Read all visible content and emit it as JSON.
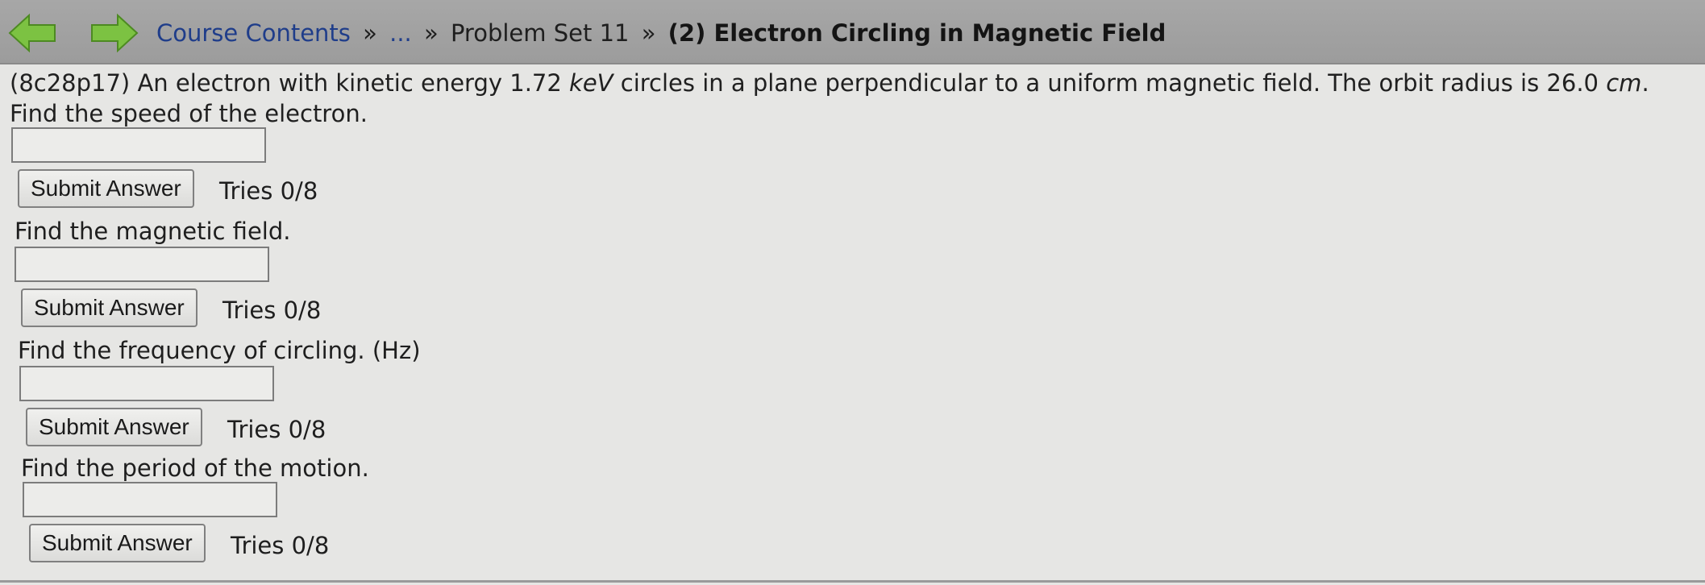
{
  "nav": {
    "back_icon": "back-arrow-icon",
    "forward_icon": "forward-arrow-icon",
    "arrow_color": "#7cc242"
  },
  "breadcrumb": {
    "course_contents": "Course Contents",
    "sep1": "»",
    "ellipsis": "...",
    "sep2": "»",
    "problem_set": "Problem Set 11",
    "sep3": "»",
    "current": "(2) Electron Circling in Magnetic Field"
  },
  "problem": {
    "prefix": "(8c28p17) An electron with kinetic energy 1.72 ",
    "unit_energy": "keV",
    "middle": " circles in a plane perpendicular to a uniform magnetic field. The orbit radius is 26.0 ",
    "unit_radius": "cm",
    "end": ".",
    "line2": "Find the speed of the electron."
  },
  "parts": [
    {
      "question": "Find the speed of the electron.",
      "answer_value": "",
      "submit_label": "Submit Answer",
      "tries": "Tries 0/8"
    },
    {
      "question": "Find the magnetic field.",
      "answer_value": "",
      "submit_label": "Submit Answer",
      "tries": "Tries 0/8"
    },
    {
      "question": "Find the frequency of circling. (Hz)",
      "answer_value": "",
      "submit_label": "Submit Answer",
      "tries": "Tries 0/8"
    },
    {
      "question": "Find the period of the motion.",
      "answer_value": "",
      "submit_label": "Submit Answer",
      "tries": "Tries 0/8"
    }
  ]
}
